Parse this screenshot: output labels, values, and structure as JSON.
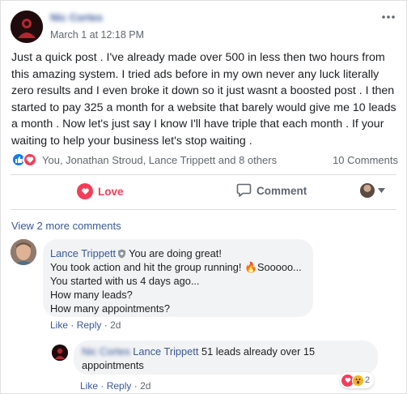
{
  "post": {
    "author": "Nic Cortes",
    "timestamp": "March 1 at 12:18 PM",
    "text": "Just a quick post . I've already made over 500 in less then two hours from this amazing system. I tried ads before in my own never any luck literally zero results and I even broke it down so it just wasnt a boosted post . I then started to pay 325 a month for a website that barely would give me 10 leads a month . Now let's just say I know I'll have triple that each month . If your waiting to help your business let's stop waiting ."
  },
  "reactions": {
    "reactors": "You, Jonathan Stroud, Lance Trippett and 8 others",
    "comments_count": "10 Comments",
    "icons": [
      "like-icon",
      "love-icon"
    ],
    "like_color": "#1877f2",
    "love_color": "#f33e58"
  },
  "actions": {
    "love_label": "Love",
    "comment_label": "Comment"
  },
  "view_more": "View 2 more comments",
  "comments": [
    {
      "author": "Lance Trippett",
      "lines": [
        "You are doing great!",
        "You took action and hit the group running! 🔥Sooooo...",
        "You started with us 4 days ago...",
        "How many leads?",
        "How many appointments?"
      ],
      "like_label": "Like",
      "reply_label": "Reply",
      "time": "2d"
    },
    {
      "author": "Nic Cortes",
      "tag": "Lance Trippett",
      "text_line1": "51 leads already over 15",
      "text_line2": "appointments",
      "like_label": "Like",
      "reply_label": "Reply",
      "time": "2d",
      "reaction_count": "2"
    }
  ],
  "separator": "·"
}
